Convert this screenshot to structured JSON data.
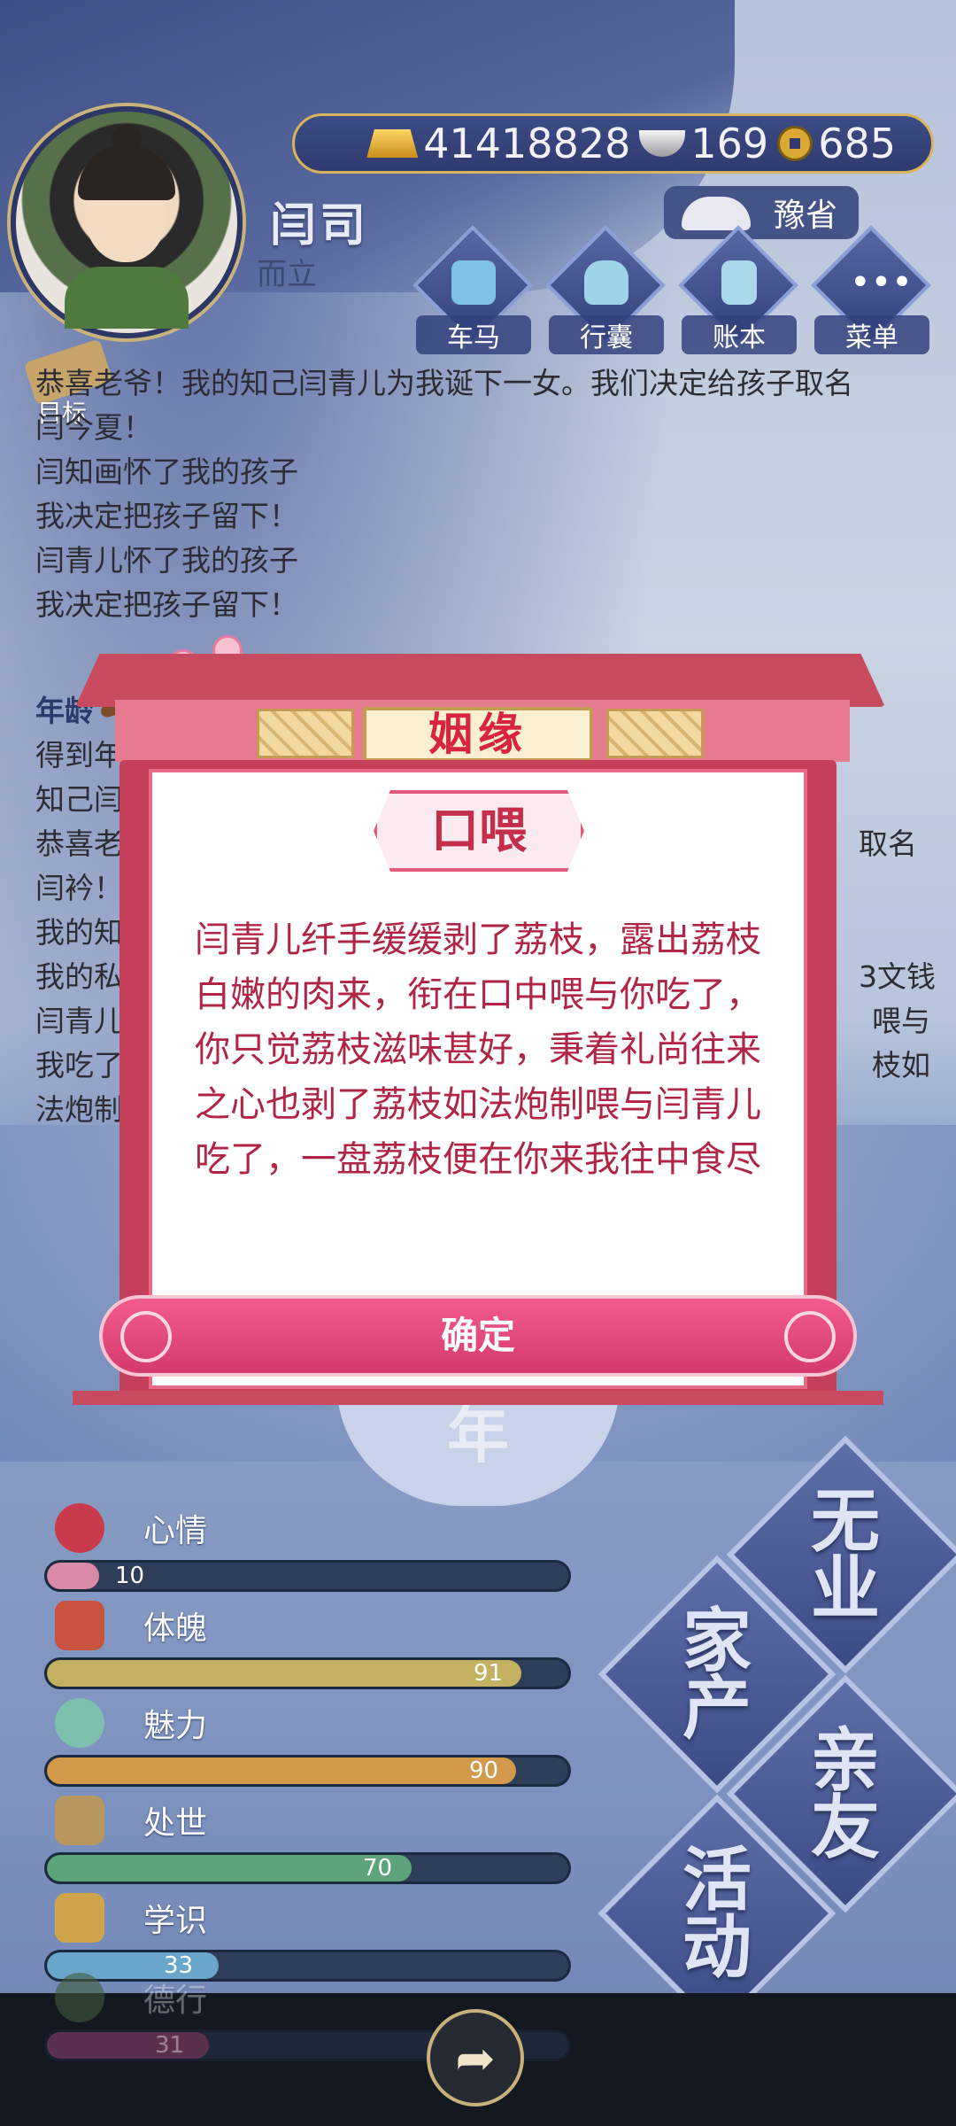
{
  "currency": {
    "gold": "41418828",
    "silver": "169",
    "coins": "685"
  },
  "player": {
    "name": "闫司",
    "age_title": "而立"
  },
  "province": "豫省",
  "nav": [
    {
      "label": "车马"
    },
    {
      "label": "行囊"
    },
    {
      "label": "账本"
    },
    {
      "label": "菜单"
    }
  ],
  "goal_label": "目标",
  "log": {
    "lines_top": [
      "恭喜老爷！我的知己闫青儿为我诞下一女。我们决定给孩子取名",
      "闫今夏！",
      "闫知画怀了我的孩子",
      "我决定把孩子留下！",
      "闫青儿怀了我的孩子",
      "我决定把孩子留下！"
    ],
    "heading_partial": "年龄",
    "lines_bottom_left": [
      "得到年",
      "知己闫",
      "恭喜老",
      "闫衿！",
      "我的知",
      "我的私",
      "闫青儿",
      "我吃了",
      "法炮制"
    ],
    "lines_bottom_right": [
      "取名",
      "3文钱",
      "喂与",
      "枝如"
    ]
  },
  "modal": {
    "title": "姻缘",
    "tag": "口喂",
    "message": "闫青儿纤手缓缓剥了荔枝，露出荔枝白嫩的肉来，衔在口中喂与你吃了，你只觉荔枝滋味甚好，秉着礼尚往来之心也剥了荔枝如法炮制喂与闫青儿吃了，一盘荔枝便在你来我往中食尽",
    "confirm": "确定"
  },
  "year_glyph": "年",
  "stats": [
    {
      "name": "心情",
      "value": "10",
      "fraction": 0.1,
      "color": "#d98aa8"
    },
    {
      "name": "体魄",
      "value": "91",
      "fraction": 0.91,
      "color": "#c3b060"
    },
    {
      "name": "魅力",
      "value": "90",
      "fraction": 0.9,
      "color": "#d39a4c"
    },
    {
      "name": "处世",
      "value": "70",
      "fraction": 0.7,
      "color": "#5fa37a"
    },
    {
      "name": "学识",
      "value": "33",
      "fraction": 0.33,
      "color": "#6aa6c9"
    },
    {
      "name": "德行",
      "value": "31",
      "fraction": 0.31,
      "color": "#b24f86"
    }
  ],
  "actions": [
    "无业",
    "家产",
    "亲友",
    "活动"
  ]
}
